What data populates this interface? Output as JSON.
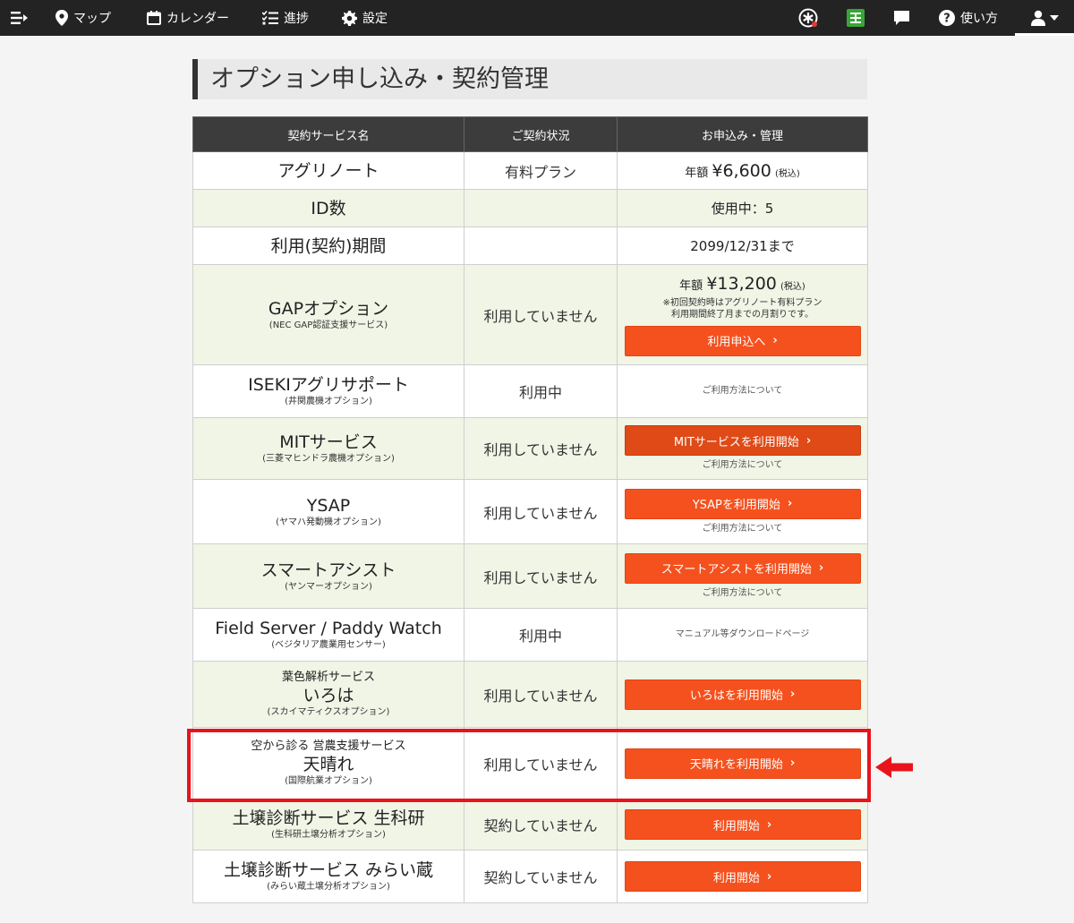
{
  "nav": {
    "left": [
      {
        "name": "menu",
        "icon": "menu-arrow-icon",
        "label": ""
      },
      {
        "name": "map",
        "icon": "map-pin-icon",
        "label": "マップ"
      },
      {
        "name": "calendar",
        "icon": "calendar-icon",
        "label": "カレンダー"
      },
      {
        "name": "progress",
        "icon": "checklist-icon",
        "label": "進捗"
      },
      {
        "name": "settings",
        "icon": "gear-icon",
        "label": "設定"
      }
    ],
    "help_label": "使い方",
    "right_icons": [
      "asterisk-circle-icon",
      "spreadsheet-icon",
      "chat-icon",
      "help-circle-icon",
      "user-icon"
    ]
  },
  "page": {
    "title": "オプション申し込み・契約管理"
  },
  "table": {
    "headers": [
      "契約サービス名",
      "ご契約状況",
      "お申込み・管理"
    ],
    "rows": [
      {
        "name": "アグリノート",
        "status": "有料プラン",
        "price_prefix": "年額",
        "price": "¥6,600",
        "tax": "(税込)"
      },
      {
        "name": "ID数",
        "status": "",
        "text": "使用中：5"
      },
      {
        "name": "利用(契約)期間",
        "status": "",
        "text": "2099/12/31まで"
      },
      {
        "name": "GAPオプション",
        "sub": "(NEC GAP認証支援サービス)",
        "status": "利用していません",
        "price_prefix": "年額",
        "price": "¥13,200",
        "tax": "(税込)",
        "note1": "※初回契約時はアグリノート有料プラン",
        "note2": "利用期間終了月までの月割りです。",
        "button": "利用申込へ"
      },
      {
        "name": "ISEKIアグリサポート",
        "sub": "(井関農機オプション)",
        "status": "利用中",
        "link": "ご利用方法について"
      },
      {
        "name": "MITサービス",
        "sub": "(三菱マヒンドラ農機オプション)",
        "status": "利用していません",
        "button": "MITサービスを利用開始",
        "link": "ご利用方法について"
      },
      {
        "name": "YSAP",
        "sub": "(ヤマハ発動機オプション)",
        "status": "利用していません",
        "button": "YSAPを利用開始",
        "link": "ご利用方法について"
      },
      {
        "name": "スマートアシスト",
        "sub": "(ヤンマーオプション)",
        "status": "利用していません",
        "button": "スマートアシストを利用開始",
        "link": "ご利用方法について"
      },
      {
        "name": "Field Server / Paddy Watch",
        "sub": "(ベジタリア農業用センサー)",
        "status": "利用中",
        "link": "マニュアル等ダウンロードページ"
      },
      {
        "pre": "葉色解析サービス",
        "name": "いろは",
        "sub": "(スカイマティクスオプション)",
        "status": "利用していません",
        "button": "いろはを利用開始"
      },
      {
        "pre": "空から診る 営農支援サービス",
        "name": "天晴れ",
        "sub": "(国際航業オプション)",
        "status": "利用していません",
        "button": "天晴れを利用開始"
      },
      {
        "name": "土壌診断サービス 生科研",
        "sub": "(生科研土壌分析オプション)",
        "status": "契約していません",
        "button": "利用開始"
      },
      {
        "name": "土壌診断サービス みらい蔵",
        "sub": "(みらい蔵土壌分析オプション)",
        "status": "契約していません",
        "button": "利用開始"
      }
    ]
  },
  "colors": {
    "accent": "#f5511e",
    "highlight": "#e8131b",
    "row_alt": "#f0f5e6",
    "header": "#3c3c3c"
  }
}
